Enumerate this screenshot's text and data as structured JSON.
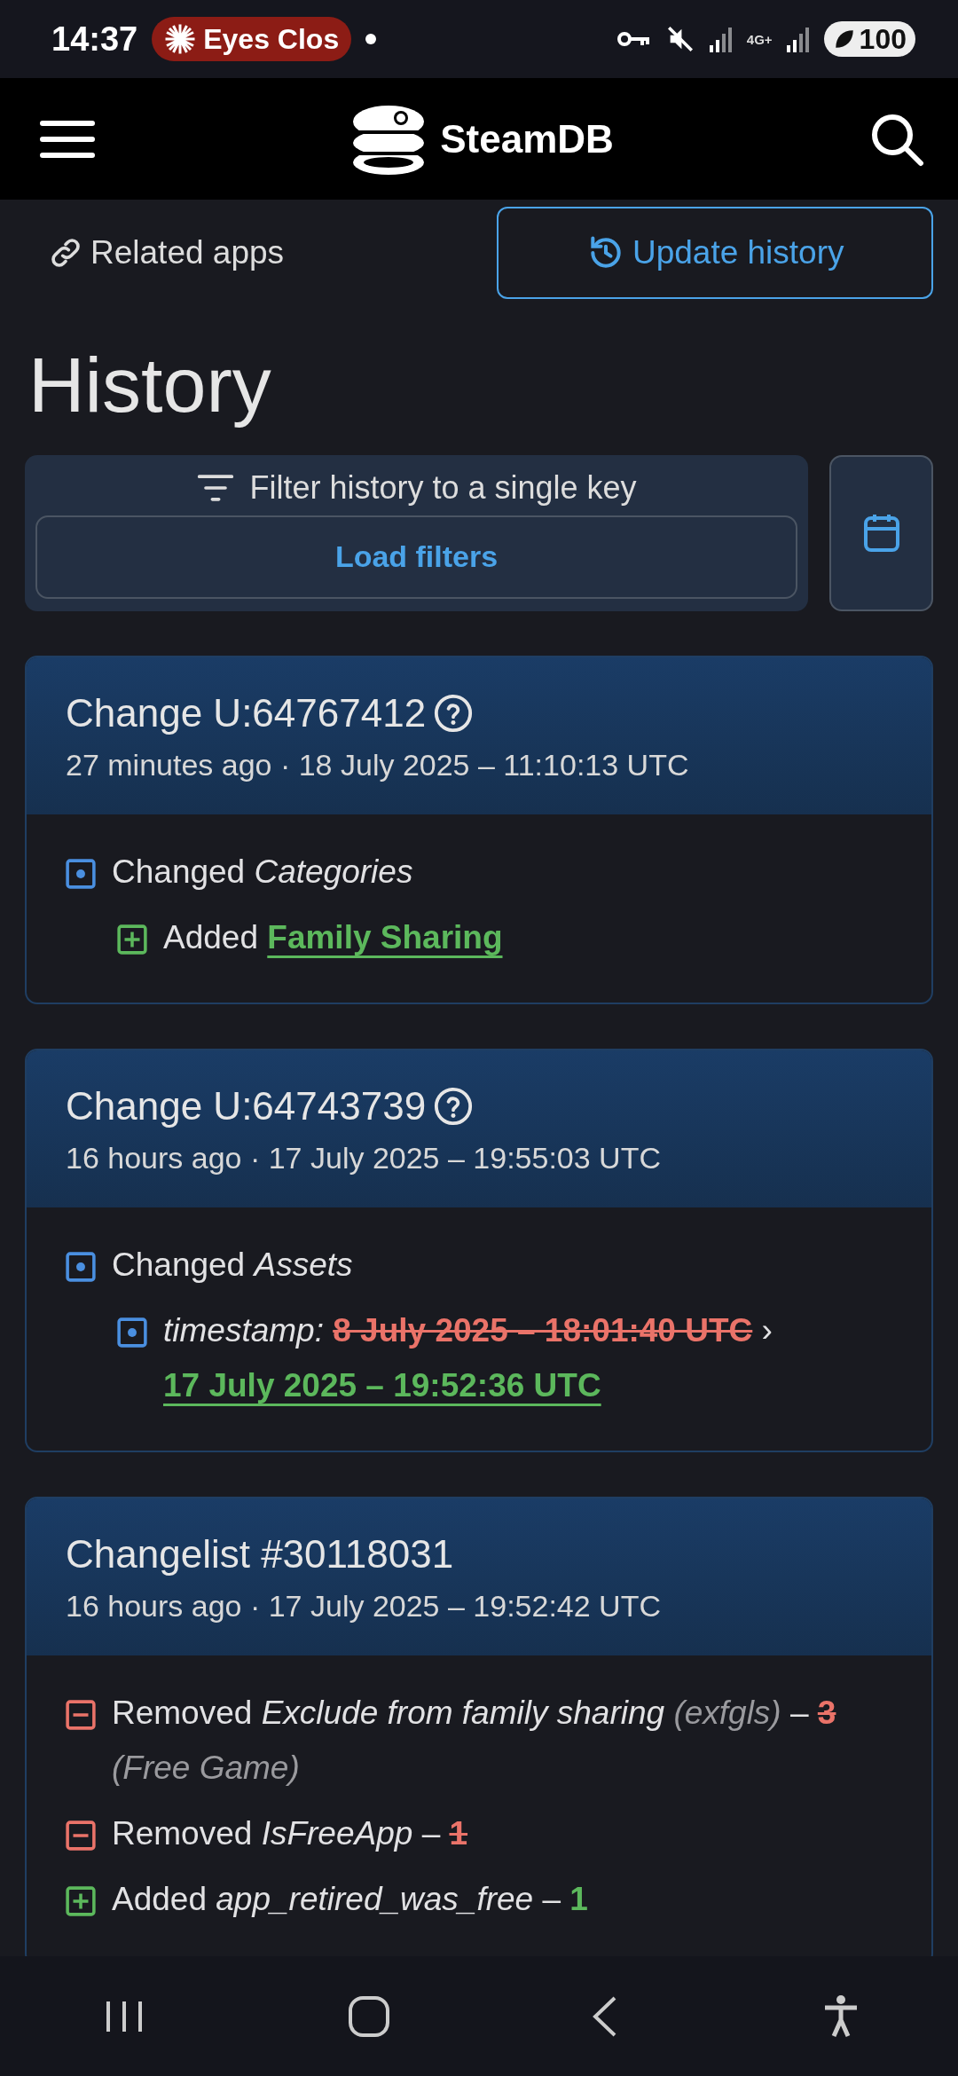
{
  "status_bar": {
    "time": "14:37",
    "pill": "Eyes Clos",
    "network": "4G+",
    "battery": "100"
  },
  "navbar": {
    "brand": "SteamDB"
  },
  "tabs": [
    {
      "label": "Related apps",
      "selected": false
    },
    {
      "label": "Update history",
      "selected": true
    }
  ],
  "heading": "History",
  "filter": {
    "label": "Filter history to a single key",
    "button": "Load filters"
  },
  "changes": [
    {
      "title": "Change U:64767412",
      "help": true,
      "time": "27 minutes ago · 18 July 2025 – 11:10:13 UTC",
      "items": [
        {
          "kind": "changed",
          "parts": [
            {
              "kind": "plain",
              "text": "Changed"
            },
            {
              "kind": "key",
              "text": "Categories"
            }
          ],
          "children": [
            {
              "kind": "added",
              "parts": [
                {
                  "kind": "plain",
                  "text": "Added"
                },
                {
                  "kind": "new_link",
                  "text": "Family Sharing"
                }
              ]
            }
          ]
        }
      ]
    },
    {
      "title": "Change U:64743739",
      "help": true,
      "time": "16 hours ago · 17 July 2025 – 19:55:03 UTC",
      "items": [
        {
          "kind": "changed",
          "parts": [
            {
              "kind": "plain",
              "text": "Changed"
            },
            {
              "kind": "key",
              "text": "Assets"
            }
          ],
          "children": [
            {
              "kind": "changed",
              "parts": [
                {
                  "kind": "key",
                  "text": "timestamp:"
                },
                {
                  "kind": "old",
                  "text": "8 July 2025 – 18:01:40 UTC"
                },
                {
                  "kind": "plain",
                  "text": "›"
                },
                {
                  "kind": "new_link",
                  "text": "17 July 2025 – 19:52:36 UTC"
                }
              ]
            }
          ]
        }
      ]
    },
    {
      "title": "Changelist #30118031",
      "help": false,
      "time": "16 hours ago · 17 July 2025 – 19:52:42 UTC",
      "items": [
        {
          "kind": "removed",
          "parts": [
            {
              "kind": "plain",
              "text": "Removed"
            },
            {
              "kind": "key",
              "text": "Exclude from family sharing"
            },
            {
              "kind": "muted",
              "text": "(exfgls)"
            },
            {
              "kind": "plain",
              "text": "–"
            },
            {
              "kind": "old",
              "text": "3"
            },
            {
              "kind": "muted",
              "text": "(Free Game)"
            }
          ]
        },
        {
          "kind": "removed",
          "parts": [
            {
              "kind": "plain",
              "text": "Removed"
            },
            {
              "kind": "key",
              "text": "IsFreeApp"
            },
            {
              "kind": "plain",
              "text": "–"
            },
            {
              "kind": "old",
              "text": "1"
            }
          ]
        },
        {
          "kind": "added",
          "parts": [
            {
              "kind": "plain",
              "text": "Added"
            },
            {
              "kind": "key",
              "text": "app_retired_was_free"
            },
            {
              "kind": "plain",
              "text": "–"
            },
            {
              "kind": "new",
              "text": "1"
            }
          ]
        }
      ]
    }
  ]
}
